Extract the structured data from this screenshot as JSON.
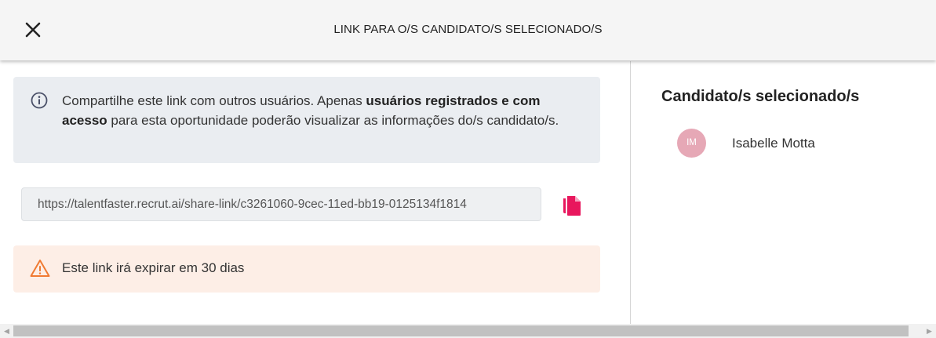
{
  "header": {
    "title": "LINK PARA O/S CANDIDATO/S SELECIONADO/S",
    "close_icon": "close-icon"
  },
  "info": {
    "icon": "info-icon",
    "text_1": "Compartilhe este link com outros usuários. Apenas ",
    "text_bold": "usuários registrados e com acesso",
    "text_2": " para esta oportunidade poderão visualizar as informações do/s candidato/s."
  },
  "share_link": {
    "value": "https://talentfaster.recrut.ai/share-link/c3261060-9cec-11ed-bb19-0125134f1814",
    "copy_icon": "copy-icon"
  },
  "warning": {
    "icon": "warning-icon",
    "text": "Este link irá expirar em 30 dias"
  },
  "candidates_panel": {
    "title": "Candidato/s selecionado/s",
    "candidates": [
      {
        "initials": "IM",
        "name": "Isabelle Motta"
      }
    ]
  },
  "colors": {
    "accent": "#e8175d",
    "warning": "#f07a32",
    "avatar_bg": "#e6a8b6",
    "info_bg": "#eaedf1",
    "warning_bg": "#fdeee6"
  },
  "scrollbar": {
    "left_arrow_icon": "scroll-left-icon",
    "right_arrow_icon": "scroll-right-icon"
  }
}
